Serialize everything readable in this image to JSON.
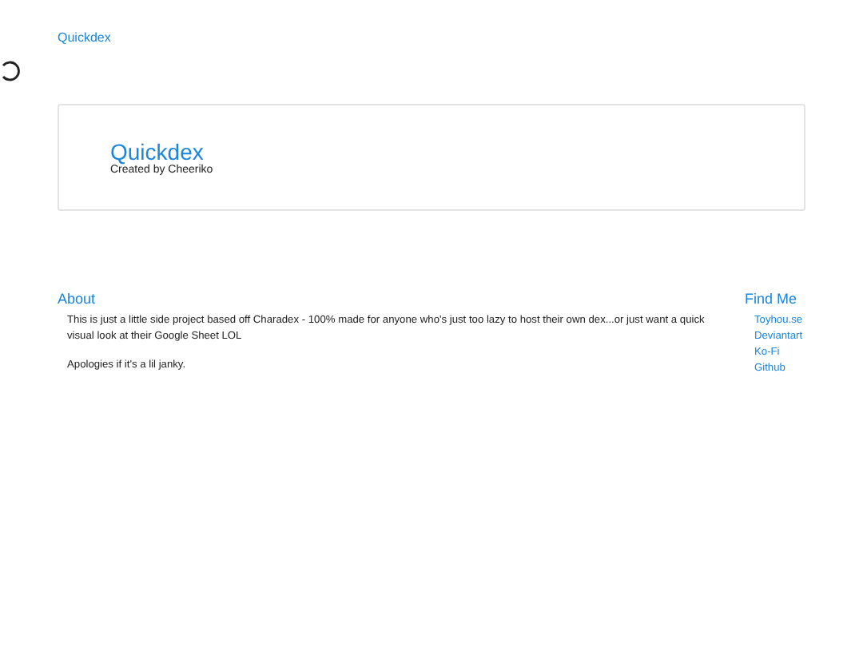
{
  "navbar": {
    "brand": "Quickdex"
  },
  "hero": {
    "title": "Quickdex",
    "subtitle": "Created by Cheeriko"
  },
  "about": {
    "heading": "About",
    "paragraphs": [
      "This is just a little side project based off Charadex - 100% made for anyone who's just too lazy to host their own dex...or just want a quick visual look at their Google Sheet LOL",
      "Apologies if it's a lil janky."
    ]
  },
  "find_me": {
    "heading": "Find Me",
    "links": [
      "Toyhou.se",
      "Deviantart",
      "Ko-Fi",
      "Github"
    ]
  }
}
